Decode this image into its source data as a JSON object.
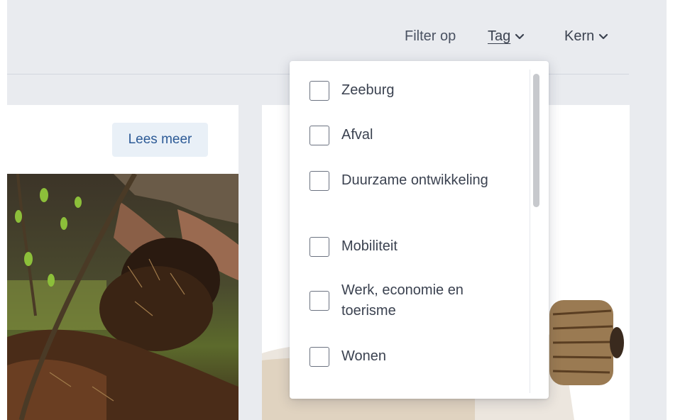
{
  "filter": {
    "label": "Filter op",
    "tabs": [
      {
        "label": "Tag",
        "active": true
      },
      {
        "label": "Kern",
        "active": false
      }
    ]
  },
  "cards": {
    "left": {
      "button_label": "Lees meer"
    }
  },
  "dropdown": {
    "options": [
      {
        "label": "Zeeburg",
        "checked": false
      },
      {
        "label": "Afval",
        "checked": false
      },
      {
        "label": "Duurzame ontwikkeling",
        "checked": false
      },
      {
        "label": "Mobiliteit",
        "checked": false
      },
      {
        "label": "Werk, economie en toerisme",
        "checked": false
      },
      {
        "label": "Wonen",
        "checked": false
      }
    ]
  },
  "colors": {
    "background": "#e9ebef",
    "text": "#3b4250",
    "link_blue": "#2c5a96",
    "button_bg": "#e9f0f7"
  },
  "icons": {
    "tab_chevron": "chevron-down-icon",
    "checkbox": "checkbox-empty-icon"
  }
}
